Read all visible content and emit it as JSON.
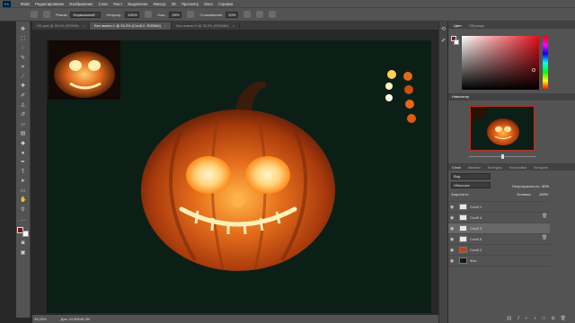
{
  "menubar": {
    "items": [
      "Файл",
      "Редактирование",
      "Изображение",
      "Слои",
      "Текст",
      "Выделение",
      "Фильтр",
      "3D",
      "Просмотр",
      "Окно",
      "Справка"
    ]
  },
  "options": {
    "mode_label": "Режим:",
    "mode_value": "Нормальный",
    "opacity_label": "Непрозр.:",
    "opacity_value": "100%",
    "pressure_label": "Наж.:",
    "pressure_value": "29%",
    "smoothing_label": "Сглаживание:",
    "smoothing_value": "10%"
  },
  "tabs": [
    {
      "label": "HD.psd @ 33,3% (RGB/8)",
      "close": "×"
    },
    {
      "label": "Без имени-1 @ 33,3% (Слой 2, RGB/8#)",
      "close": "×"
    },
    {
      "label": "Без имени-3 @ 33,3% (RGB/8#)",
      "close": "×"
    }
  ],
  "status": {
    "zoom": "33,33%",
    "doc": "Док: 24,9M/46,2M"
  },
  "panels": {
    "color_tabs": [
      "Цвет",
      "Образцы"
    ],
    "navigator_title": "Навигатор",
    "layers_tabs": [
      "Слои",
      "Каналы",
      "Контуры",
      "Настройки",
      "История"
    ],
    "kind": "Вид",
    "blend_mode": "Обычные",
    "opacity_label": "Непрозрачность:",
    "opacity_value": "40%",
    "lock_label": "Закрепить:",
    "fill_label": "Заливка:",
    "fill_value": "100%",
    "layers": [
      {
        "name": "Слой 1",
        "selected": false
      },
      {
        "name": "Слой 4",
        "selected": false
      },
      {
        "name": "Слой 3",
        "selected": true
      },
      {
        "name": "Слой 5",
        "selected": false
      },
      {
        "name": "Слой 2",
        "selected": false
      },
      {
        "name": "Фон",
        "selected": false
      }
    ]
  },
  "colors": {
    "canvas_bg": "#0c1f17",
    "pumpkin_orange": "#e0651a",
    "glow": "#ffd27a",
    "foreground_swatch": "#7a1515"
  }
}
